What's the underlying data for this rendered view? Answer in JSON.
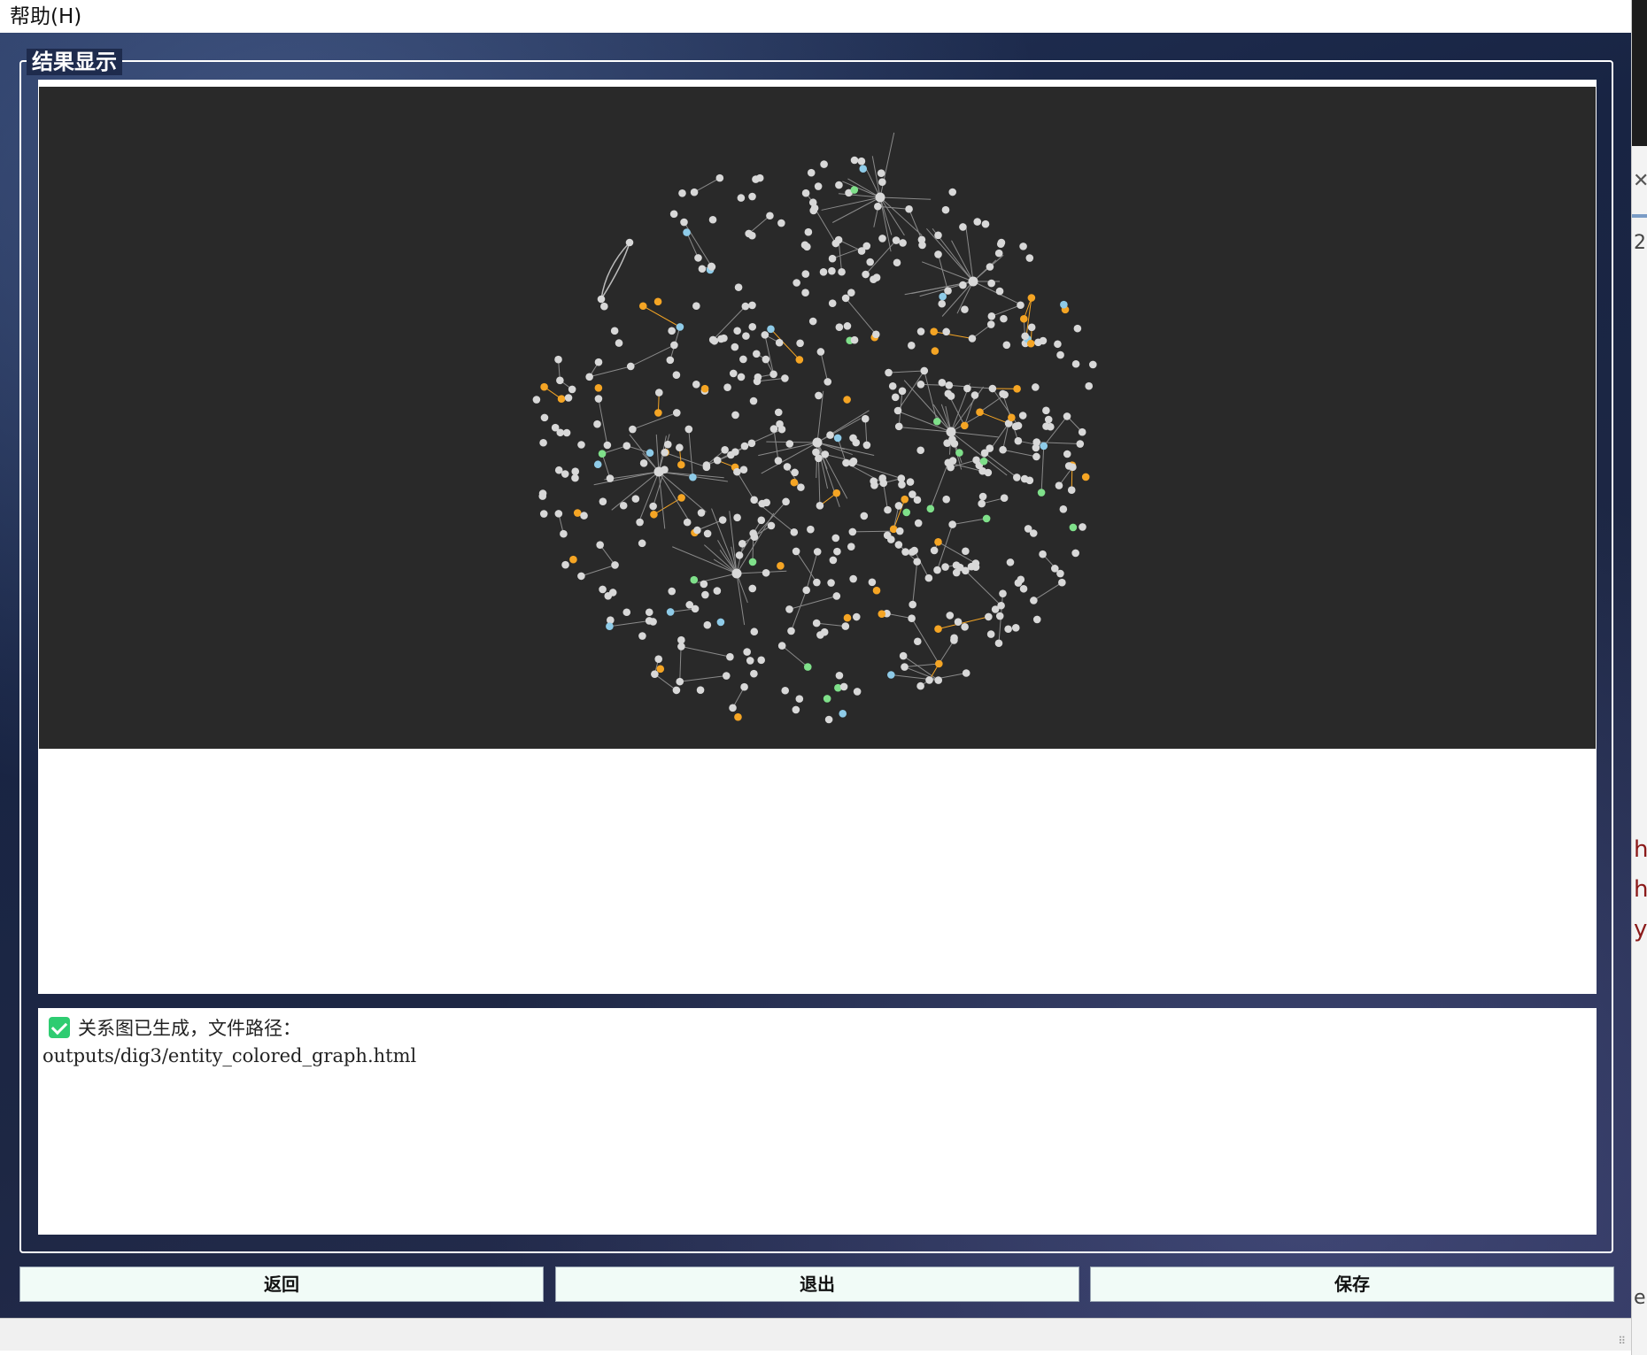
{
  "menu": {
    "help_label": "帮助(H)"
  },
  "group": {
    "title": "结果显示"
  },
  "log": {
    "line1": "关系图已生成，文件路径：",
    "line2": "outputs/dig3/entity_colored_graph.html"
  },
  "buttons": {
    "back": "返回",
    "exit": "退出",
    "save": "保存"
  },
  "behind_window": {
    "digit": "2",
    "chars": [
      "h",
      "h",
      "y"
    ],
    "last": "e"
  },
  "graph": {
    "node_colors": {
      "default": "#d8d8d8",
      "orange": "#f5a524",
      "blue": "#8ecbe8",
      "green": "#7fe08a"
    },
    "edge_color": "#8a8a8a",
    "background": "#292929"
  }
}
